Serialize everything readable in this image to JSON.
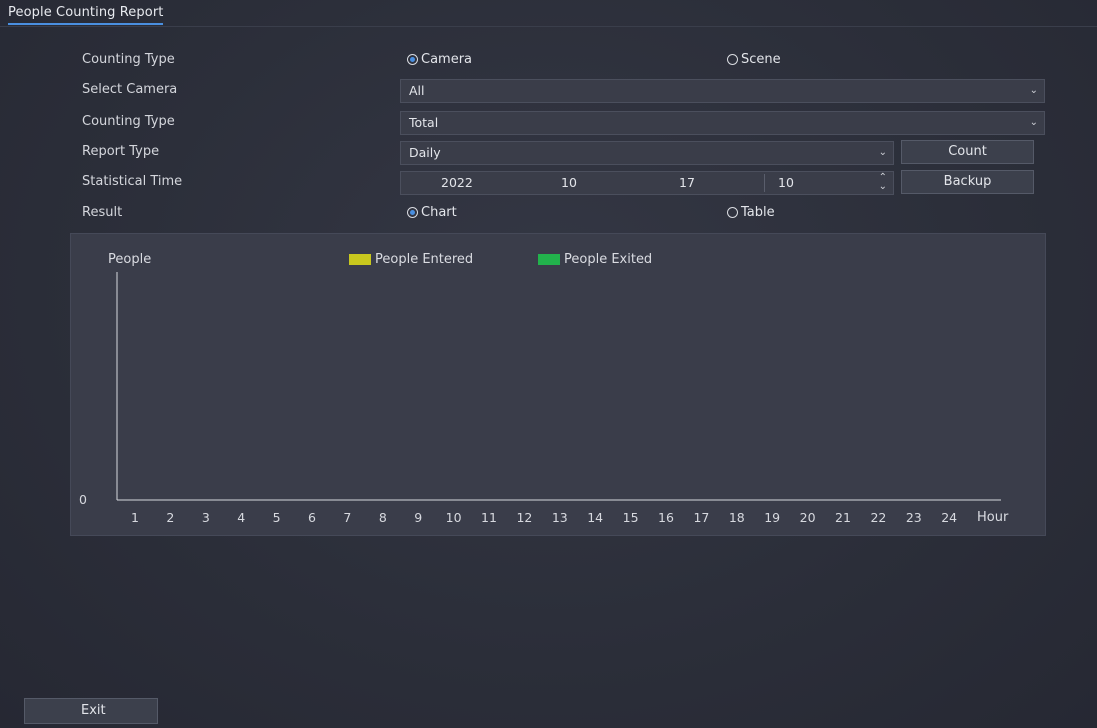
{
  "tab": {
    "title": "People Counting Report"
  },
  "form": {
    "counting_type_label": "Counting Type",
    "counting_type_options": {
      "camera": "Camera",
      "scene": "Scene"
    },
    "select_camera_label": "Select Camera",
    "select_camera_value": "All",
    "counting_type2_label": "Counting Type",
    "counting_type2_value": "Total",
    "report_type_label": "Report Type",
    "report_type_value": "Daily",
    "statistical_time_label": "Statistical Time",
    "date": {
      "year": "2022",
      "month": "10",
      "day": "17",
      "hour": "10"
    },
    "result_label": "Result",
    "result_options": {
      "chart": "Chart",
      "table": "Table"
    }
  },
  "buttons": {
    "count": "Count",
    "backup": "Backup",
    "exit": "Exit"
  },
  "chart_data": {
    "type": "bar",
    "ylabel": "People",
    "xlabel": "Hour",
    "categories": [
      "1",
      "2",
      "3",
      "4",
      "5",
      "6",
      "7",
      "8",
      "9",
      "10",
      "11",
      "12",
      "13",
      "14",
      "15",
      "16",
      "17",
      "18",
      "19",
      "20",
      "21",
      "22",
      "23",
      "24"
    ],
    "y_ticks": [
      "0"
    ],
    "series": [
      {
        "name": "People Entered",
        "color": "#c8c81e",
        "values": [
          0,
          0,
          0,
          0,
          0,
          0,
          0,
          0,
          0,
          0,
          0,
          0,
          0,
          0,
          0,
          0,
          0,
          0,
          0,
          0,
          0,
          0,
          0,
          0
        ]
      },
      {
        "name": "People Exited",
        "color": "#22b24c",
        "values": [
          0,
          0,
          0,
          0,
          0,
          0,
          0,
          0,
          0,
          0,
          0,
          0,
          0,
          0,
          0,
          0,
          0,
          0,
          0,
          0,
          0,
          0,
          0,
          0
        ]
      }
    ]
  },
  "colors": {
    "accent": "#4a8fe0"
  }
}
